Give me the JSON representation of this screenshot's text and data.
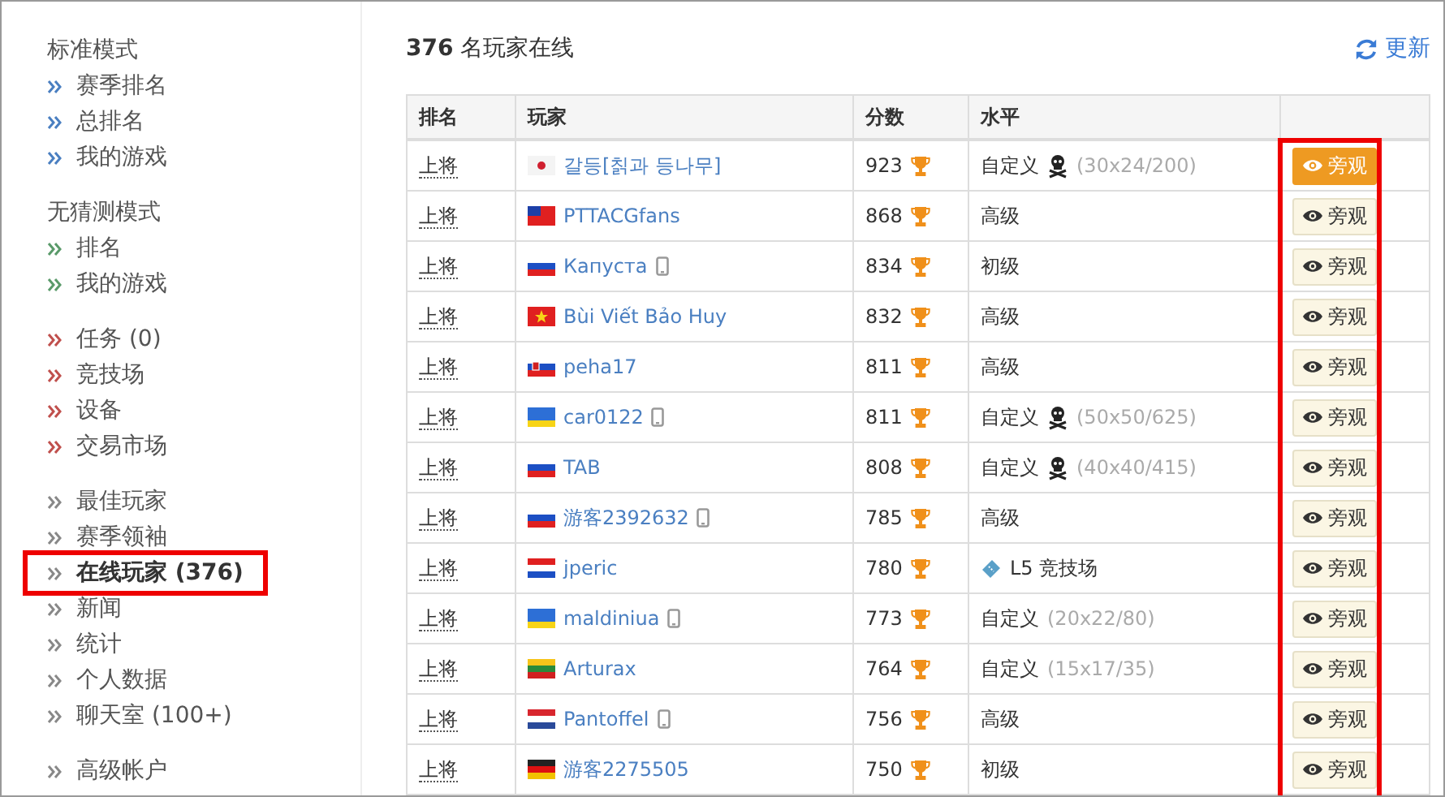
{
  "sidebar": {
    "groups": [
      {
        "title": "标准模式",
        "color": "#4a7fc1",
        "items": [
          {
            "label": "赛季排名",
            "selected": false
          },
          {
            "label": "总排名",
            "selected": false
          },
          {
            "label": "我的游戏",
            "selected": false
          }
        ]
      },
      {
        "title": "无猜测模式",
        "color": "#5a9a6a",
        "items": [
          {
            "label": "排名",
            "selected": false
          },
          {
            "label": "我的游戏",
            "selected": false
          }
        ]
      },
      {
        "color": "#c0504d",
        "items": [
          {
            "label": "任务 (0)",
            "selected": false
          },
          {
            "label": "竞技场",
            "selected": false
          },
          {
            "label": "设备",
            "selected": false
          },
          {
            "label": "交易市场",
            "selected": false
          }
        ]
      },
      {
        "color": "#888888",
        "items": [
          {
            "label": "最佳玩家",
            "selected": false
          },
          {
            "label": "赛季领袖",
            "selected": false
          },
          {
            "label": "在线玩家 (376)",
            "selected": true
          },
          {
            "label": "新闻",
            "selected": false
          },
          {
            "label": "统计",
            "selected": false
          },
          {
            "label": "个人数据",
            "selected": false
          },
          {
            "label": "聊天室 (100+)",
            "selected": false
          }
        ]
      },
      {
        "color": "#888888",
        "items": [
          {
            "label": "高级帐户",
            "selected": false
          }
        ]
      }
    ]
  },
  "header": {
    "count": "376",
    "title": "名玩家在线",
    "refresh": "更新"
  },
  "table": {
    "columns": [
      "排名",
      "玩家",
      "分数",
      "水平"
    ],
    "highlight_action_column": true,
    "rows": [
      {
        "rank": "上将",
        "player": "갈등[칡과 등나무]",
        "mobile": false,
        "score": "923",
        "level": {
          "kind": "mine",
          "text": "自定义",
          "detail": "(30x24/200)"
        },
        "action": {
          "label": "旁观",
          "selected": true
        }
      },
      {
        "rank": "上将",
        "player": "PTTACGfans",
        "mobile": false,
        "score": "868",
        "level": {
          "text": "高级"
        },
        "action": {
          "label": "旁观",
          "selected": false
        }
      },
      {
        "rank": "上将",
        "player": "Капуста",
        "mobile": true,
        "score": "834",
        "level": {
          "text": "初级"
        },
        "action": {
          "label": "旁观",
          "selected": false
        }
      },
      {
        "rank": "上将",
        "player": "Bùi Viết Bảo Huy",
        "mobile": false,
        "score": "832",
        "level": {
          "text": "高级"
        },
        "action": {
          "label": "旁观",
          "selected": false
        }
      },
      {
        "rank": "上将",
        "player": "peha17",
        "mobile": false,
        "score": "811",
        "level": {
          "text": "高级"
        },
        "action": {
          "label": "旁观",
          "selected": false
        }
      },
      {
        "rank": "上将",
        "player": "car0122",
        "mobile": true,
        "score": "811",
        "level": {
          "kind": "mine",
          "text": "自定义",
          "detail": "(50x50/625)"
        },
        "action": {
          "label": "旁观",
          "selected": false
        }
      },
      {
        "rank": "上将",
        "player": "TAB",
        "mobile": false,
        "score": "808",
        "level": {
          "kind": "mine",
          "text": "自定义",
          "detail": "(40x40/415)"
        },
        "action": {
          "label": "旁观",
          "selected": false
        }
      },
      {
        "rank": "上将",
        "player": "游客2392632",
        "mobile": true,
        "score": "785",
        "level": {
          "text": "高级"
        },
        "action": {
          "label": "旁观",
          "selected": false
        }
      },
      {
        "rank": "上将",
        "player": "jperic",
        "mobile": false,
        "score": "780",
        "level": {
          "kind": "arena",
          "text": "L5 竞技场"
        },
        "action": {
          "label": "旁观",
          "selected": false
        }
      },
      {
        "rank": "上将",
        "player": "maldiniua",
        "mobile": true,
        "score": "773",
        "level": {
          "text": "自定义",
          "detail": "(20x22/80)"
        },
        "action": {
          "label": "旁观",
          "selected": false
        }
      },
      {
        "rank": "上将",
        "player": "Arturax",
        "mobile": false,
        "score": "764",
        "level": {
          "text": "自定义",
          "detail": "(15x17/35)"
        },
        "action": {
          "label": "旁观",
          "selected": false
        }
      },
      {
        "rank": "上将",
        "player": "Pantoffel",
        "mobile": true,
        "score": "756",
        "level": {
          "text": "高级"
        },
        "action": {
          "label": "旁观",
          "selected": false
        }
      },
      {
        "rank": "上将",
        "player": "游客2275505",
        "mobile": false,
        "score": "750",
        "level": {
          "text": "初级"
        },
        "action": {
          "label": "旁观",
          "selected": false
        }
      }
    ]
  }
}
